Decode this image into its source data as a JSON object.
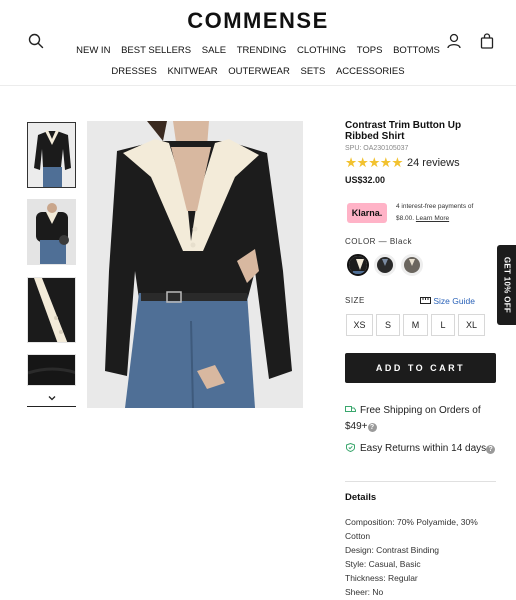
{
  "brand": {
    "logo": "COMMENSE"
  },
  "nav": {
    "row1": [
      "NEW IN",
      "BEST SELLERS",
      "SALE",
      "TRENDING",
      "CLOTHING",
      "TOPS",
      "BOTTOMS"
    ],
    "row2": [
      "DRESSES",
      "KNITWEAR",
      "OUTERWEAR",
      "SETS",
      "ACCESSORIES"
    ]
  },
  "icons": {
    "search": "search-icon",
    "account": "user-icon",
    "cart": "bag-icon",
    "thumbs_down": "chevron-down-icon"
  },
  "product": {
    "title": "Contrast Trim Button Up Ribbed Shirt",
    "spu": "SPU: OA230105037",
    "rating": {
      "stars": "★★★★★",
      "reviews": "24 reviews"
    },
    "price": "US$32.00",
    "klarna": {
      "badge": "Klarna.",
      "line1": "4 interest-free payments of",
      "amount": "$8.00.",
      "learn_more": "Learn More"
    },
    "color": {
      "label": "COLOR",
      "selected": "Black"
    },
    "size": {
      "label": "SIZE",
      "guide": "Size Guide",
      "options": [
        "XS",
        "S",
        "M",
        "L",
        "XL"
      ]
    },
    "add_to_cart": "ADD TO CART",
    "perks": {
      "shipping": "Free Shipping on Orders of $49+",
      "returns": "Easy Returns within 14 days"
    },
    "details": {
      "heading": "Details",
      "lines": [
        "Composition: 70% Polyamide, 30% Cotton",
        "Design: Contrast Binding",
        "Style: Casual, Basic",
        "Thickness: Regular",
        "Sheer: No"
      ]
    }
  },
  "promo_tab": "GET 10% OFF",
  "colors": {
    "accent": "#1c1c1c",
    "stars": "#f2c230",
    "klarna": "#ffb3c7",
    "link": "#2a62b8"
  }
}
